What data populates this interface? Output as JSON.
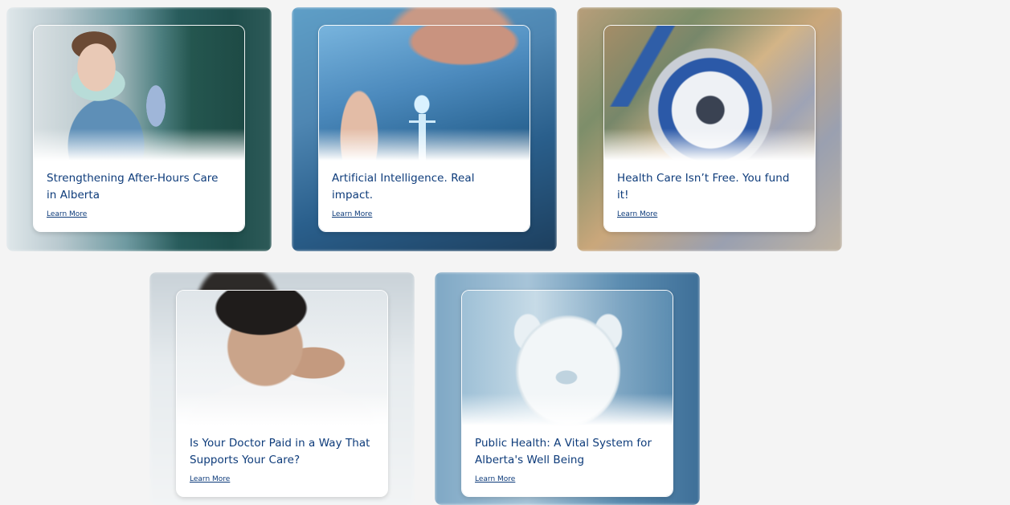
{
  "colors": {
    "page_bg": "#f4f4f4",
    "title_color": "#0d3b7a",
    "link_color": "#0d3b7a",
    "card_panel_bg": "#ffffff"
  },
  "cards": [
    {
      "title": "Strengthening After-Hours Care in Alberta",
      "link_label": "Learn More",
      "image": "nurse-with-mask-image"
    },
    {
      "title": "Artificial Intelligence. Real impact.",
      "link_label": "Learn More",
      "image": "ai-digital-body-image"
    },
    {
      "title": "Health Care Isn’t Free. You fund it!",
      "link_label": "Learn More",
      "image": "stethoscope-on-money-image"
    },
    {
      "title": "Is Your Doctor Paid in a Way That Supports Your Care?",
      "link_label": "Learn More",
      "image": "stressed-doctor-image"
    },
    {
      "title": "Public Health: A Vital System for Alberta's Well Being",
      "link_label": "Learn More",
      "image": "piggy-bank-image"
    }
  ]
}
